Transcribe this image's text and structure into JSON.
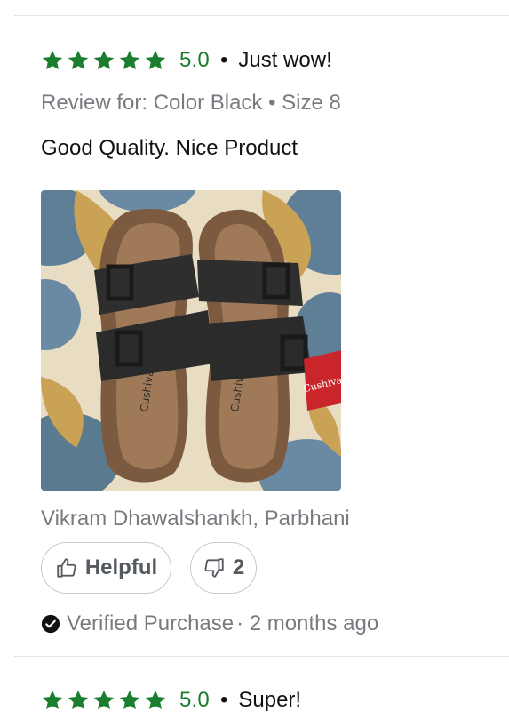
{
  "reviews": [
    {
      "score": "5.0",
      "separator": "•",
      "title": "Just wow!",
      "meta": "Review for: Color Black • Size 8",
      "body": "Good Quality. Nice Product",
      "author": "Vikram Dhawalshankh, Parbhani",
      "helpful_label": "Helpful",
      "dislike_count": "2",
      "verified_label": "Verified Purchase",
      "time_ago": "· 2 months ago",
      "rating_stars": 5
    },
    {
      "score": "5.0",
      "separator": "•",
      "title": "Super!",
      "rating_stars": 5
    }
  ],
  "photo": {
    "brand_print": "Cushiva",
    "icon": "sandals-photo"
  },
  "colors": {
    "star": "#1b7d2e",
    "muted_text": "#777b80",
    "divider": "#e3e3e3"
  }
}
